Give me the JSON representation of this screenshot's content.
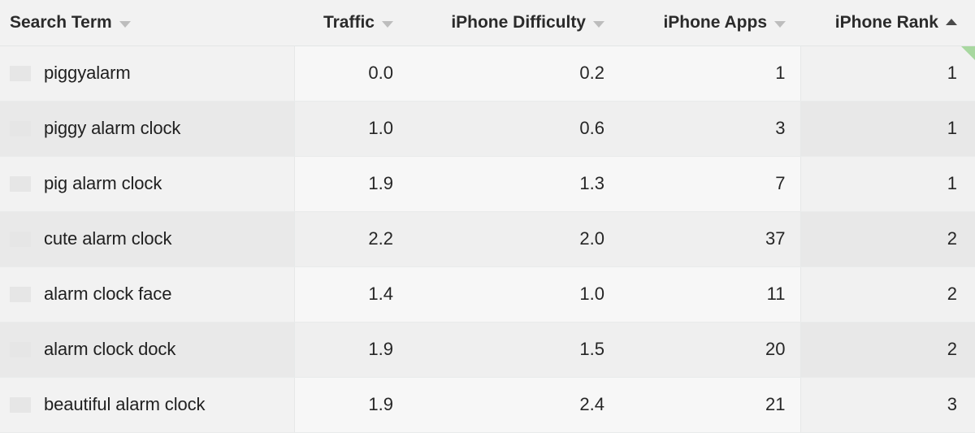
{
  "table": {
    "columns": [
      {
        "key": "search_term",
        "label": "Search Term",
        "sort_icon": "chevron-down-icon",
        "sorted": false,
        "align": "left"
      },
      {
        "key": "traffic",
        "label": "Traffic",
        "sort_icon": "chevron-down-icon",
        "sorted": false,
        "align": "right"
      },
      {
        "key": "difficulty",
        "label": "iPhone Difficulty",
        "sort_icon": "chevron-down-icon",
        "sorted": false,
        "align": "right"
      },
      {
        "key": "apps",
        "label": "iPhone Apps",
        "sort_icon": "chevron-down-icon",
        "sorted": false,
        "align": "right"
      },
      {
        "key": "rank",
        "label": "iPhone Rank",
        "sort_icon": "chevron-up-icon",
        "sorted": true,
        "sort_direction": "ascending",
        "align": "right"
      }
    ],
    "rows": [
      {
        "flag": "us-flag-icon",
        "search_term": "piggyalarm",
        "traffic": "0.0",
        "difficulty": "0.2",
        "apps": "1",
        "rank": "1",
        "rank_highlight": true
      },
      {
        "flag": "us-flag-icon",
        "search_term": "piggy alarm clock",
        "traffic": "1.0",
        "difficulty": "0.6",
        "apps": "3",
        "rank": "1",
        "rank_highlight": false
      },
      {
        "flag": "us-flag-icon",
        "search_term": "pig alarm clock",
        "traffic": "1.9",
        "difficulty": "1.3",
        "apps": "7",
        "rank": "1",
        "rank_highlight": false
      },
      {
        "flag": "us-flag-icon",
        "search_term": "cute alarm clock",
        "traffic": "2.2",
        "difficulty": "2.0",
        "apps": "37",
        "rank": "2",
        "rank_highlight": false
      },
      {
        "flag": "us-flag-icon",
        "search_term": "alarm clock face",
        "traffic": "1.4",
        "difficulty": "1.0",
        "apps": "11",
        "rank": "2",
        "rank_highlight": false
      },
      {
        "flag": "us-flag-icon",
        "search_term": "alarm clock dock",
        "traffic": "1.9",
        "difficulty": "1.5",
        "apps": "20",
        "rank": "2",
        "rank_highlight": false
      },
      {
        "flag": "us-flag-icon",
        "search_term": "beautiful alarm clock",
        "traffic": "1.9",
        "difficulty": "2.4",
        "apps": "21",
        "rank": "3",
        "rank_highlight": false
      }
    ]
  },
  "colors": {
    "header_bg": "#f2f2f2",
    "row_odd_bg": "#f7f7f7",
    "row_even_bg": "#efefef",
    "text": "#262626",
    "sort_inactive": "#bdbdbd",
    "sort_active": "#4a4a4a",
    "corner_flag": "#a8d8a0"
  }
}
